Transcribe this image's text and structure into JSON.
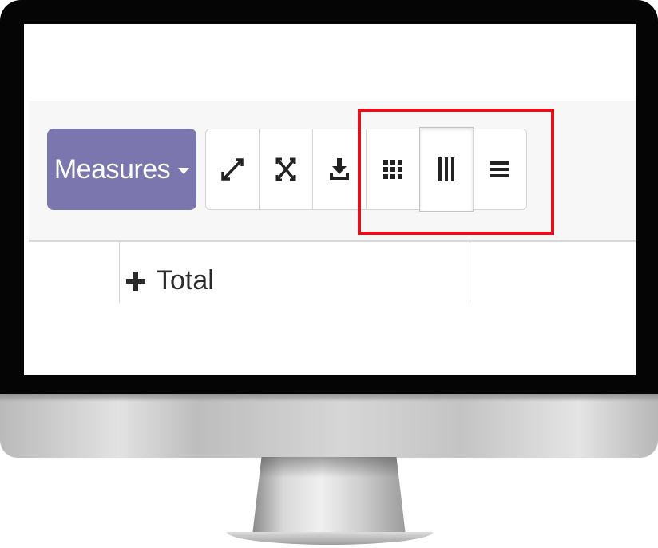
{
  "toolbar": {
    "measures_label": "Measures",
    "buttons": [
      {
        "icon": "expand-icon"
      },
      {
        "icon": "flip-axis-icon"
      },
      {
        "icon": "download-icon"
      },
      {
        "icon": "grid-view-icon"
      },
      {
        "icon": "column-view-icon"
      },
      {
        "icon": "list-view-icon"
      }
    ]
  },
  "table": {
    "header_label": "Total"
  },
  "colors": {
    "measures_bg": "#7b76ad",
    "highlight": "#e1121b"
  }
}
